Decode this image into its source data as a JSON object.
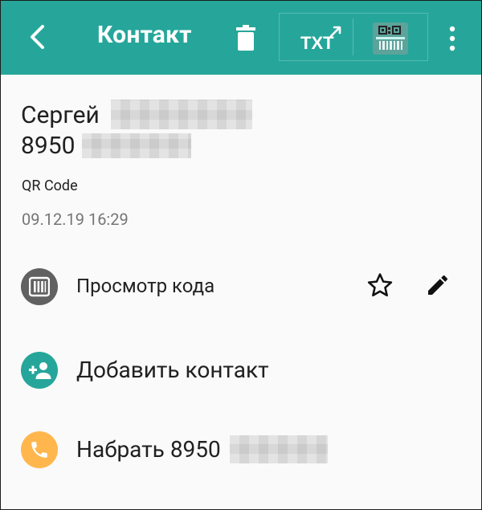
{
  "toolbar": {
    "title": "Контакт",
    "background_color": "#26a69a",
    "icons": {
      "back": "arrow-back-icon",
      "delete": "trash-icon",
      "export_txt": "txt-export-icon",
      "qr": "qr-code-icon",
      "more": "more-vertical-icon"
    },
    "txt_label": "TXT"
  },
  "contact": {
    "name": "Сергей",
    "phone": "8950"
  },
  "meta": {
    "code_type": "QR Code",
    "timestamp": "09.12.19 16:29"
  },
  "actions": [
    {
      "label": "Просмотр кода",
      "icon": "barcode-icon",
      "color": "#616161"
    },
    {
      "label": "Добавить контакт",
      "icon": "add-person-icon",
      "color": "#26a69a"
    },
    {
      "label": "Набрать 8950",
      "icon": "phone-icon",
      "color": "#ffb74d"
    }
  ],
  "row_tools": {
    "favorite_icon": "star-outline-icon",
    "edit_icon": "pencil-icon"
  }
}
